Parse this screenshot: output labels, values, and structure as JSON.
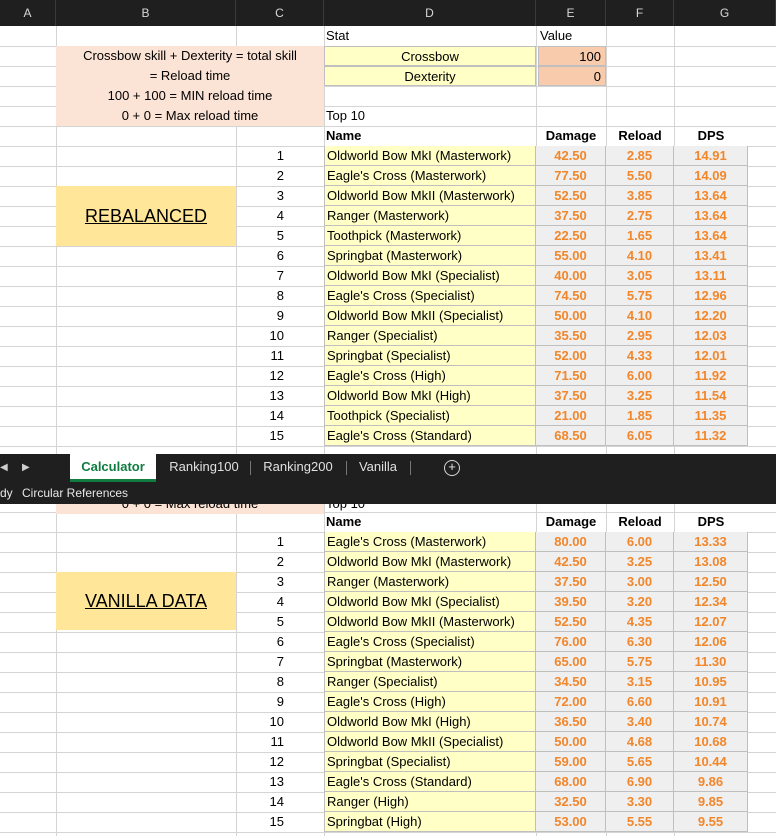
{
  "columns": [
    "A",
    "B",
    "C",
    "D",
    "E",
    "F",
    "G"
  ],
  "top": {
    "stat_header": "Stat",
    "value_header": "Value",
    "notes": [
      "Crossbow skill + Dexterity = total skill",
      "= Reload time",
      "100 + 100 = MIN reload time",
      "0 + 0 = Max reload time"
    ],
    "crossbow_label": "Crossbow",
    "crossbow_value": "100",
    "dexterity_label": "Dexterity",
    "dexterity_value": "0",
    "top10": "Top 10",
    "tag": "REBALANCED",
    "headers": {
      "name": "Name",
      "damage": "Damage",
      "reload": "Reload",
      "dps": "DPS"
    },
    "rows": [
      {
        "n": "1",
        "name": "Oldworld Bow MkI (Masterwork)",
        "damage": "42.50",
        "reload": "2.85",
        "dps": "14.91"
      },
      {
        "n": "2",
        "name": "Eagle's Cross (Masterwork)",
        "damage": "77.50",
        "reload": "5.50",
        "dps": "14.09"
      },
      {
        "n": "3",
        "name": "Oldworld Bow MkII (Masterwork)",
        "damage": "52.50",
        "reload": "3.85",
        "dps": "13.64"
      },
      {
        "n": "4",
        "name": "Ranger (Masterwork)",
        "damage": "37.50",
        "reload": "2.75",
        "dps": "13.64"
      },
      {
        "n": "5",
        "name": "Toothpick (Masterwork)",
        "damage": "22.50",
        "reload": "1.65",
        "dps": "13.64"
      },
      {
        "n": "6",
        "name": "Springbat (Masterwork)",
        "damage": "55.00",
        "reload": "4.10",
        "dps": "13.41"
      },
      {
        "n": "7",
        "name": "Oldworld Bow MkI (Specialist)",
        "damage": "40.00",
        "reload": "3.05",
        "dps": "13.11"
      },
      {
        "n": "8",
        "name": "Eagle's Cross (Specialist)",
        "damage": "74.50",
        "reload": "5.75",
        "dps": "12.96"
      },
      {
        "n": "9",
        "name": "Oldworld Bow MkII (Specialist)",
        "damage": "50.00",
        "reload": "4.10",
        "dps": "12.20"
      },
      {
        "n": "10",
        "name": "Ranger (Specialist)",
        "damage": "35.50",
        "reload": "2.95",
        "dps": "12.03"
      },
      {
        "n": "11",
        "name": "Springbat (Specialist)",
        "damage": "52.00",
        "reload": "4.33",
        "dps": "12.01"
      },
      {
        "n": "12",
        "name": "Eagle's Cross (High)",
        "damage": "71.50",
        "reload": "6.00",
        "dps": "11.92"
      },
      {
        "n": "13",
        "name": "Oldworld Bow MkI (High)",
        "damage": "37.50",
        "reload": "3.25",
        "dps": "11.54"
      },
      {
        "n": "14",
        "name": "Toothpick (Specialist)",
        "damage": "21.00",
        "reload": "1.85",
        "dps": "11.35"
      },
      {
        "n": "15",
        "name": "Eagle's Cross (Standard)",
        "damage": "68.50",
        "reload": "6.05",
        "dps": "11.32"
      }
    ]
  },
  "tabs": {
    "items": [
      "Calculator",
      "Ranking100",
      "Ranking200",
      "Vanilla"
    ],
    "active": "Calculator",
    "add_symbol": "+"
  },
  "statusbar": {
    "left": "dy",
    "circular": "Circular References"
  },
  "bottom": {
    "partial_note": "0 + 0 = Max reload time",
    "partial_top10": "Top 10",
    "tag": "VANILLA DATA",
    "headers": {
      "name": "Name",
      "damage": "Damage",
      "reload": "Reload",
      "dps": "DPS"
    },
    "rows": [
      {
        "n": "1",
        "name": "Eagle's Cross (Masterwork)",
        "damage": "80.00",
        "reload": "6.00",
        "dps": "13.33"
      },
      {
        "n": "2",
        "name": "Oldworld Bow MkI (Masterwork)",
        "damage": "42.50",
        "reload": "3.25",
        "dps": "13.08"
      },
      {
        "n": "3",
        "name": "Ranger (Masterwork)",
        "damage": "37.50",
        "reload": "3.00",
        "dps": "12.50"
      },
      {
        "n": "4",
        "name": "Oldworld Bow MkI (Specialist)",
        "damage": "39.50",
        "reload": "3.20",
        "dps": "12.34"
      },
      {
        "n": "5",
        "name": "Oldworld Bow MkII (Masterwork)",
        "damage": "52.50",
        "reload": "4.35",
        "dps": "12.07"
      },
      {
        "n": "6",
        "name": "Eagle's Cross (Specialist)",
        "damage": "76.00",
        "reload": "6.30",
        "dps": "12.06"
      },
      {
        "n": "7",
        "name": "Springbat (Masterwork)",
        "damage": "65.00",
        "reload": "5.75",
        "dps": "11.30"
      },
      {
        "n": "8",
        "name": "Ranger (Specialist)",
        "damage": "34.50",
        "reload": "3.15",
        "dps": "10.95"
      },
      {
        "n": "9",
        "name": "Eagle's Cross (High)",
        "damage": "72.00",
        "reload": "6.60",
        "dps": "10.91"
      },
      {
        "n": "10",
        "name": "Oldworld Bow MkI (High)",
        "damage": "36.50",
        "reload": "3.40",
        "dps": "10.74"
      },
      {
        "n": "11",
        "name": "Oldworld Bow MkII (Specialist)",
        "damage": "50.00",
        "reload": "4.68",
        "dps": "10.68"
      },
      {
        "n": "12",
        "name": "Springbat (Specialist)",
        "damage": "59.00",
        "reload": "5.65",
        "dps": "10.44"
      },
      {
        "n": "13",
        "name": "Eagle's Cross (Standard)",
        "damage": "68.00",
        "reload": "6.90",
        "dps": "9.86"
      },
      {
        "n": "14",
        "name": "Ranger (High)",
        "damage": "32.50",
        "reload": "3.30",
        "dps": "9.85"
      },
      {
        "n": "15",
        "name": "Springbat (High)",
        "damage": "53.00",
        "reload": "5.55",
        "dps": "9.55"
      }
    ]
  },
  "colors": {
    "name_bg": "#ffffc6",
    "value_text": "#f2862a",
    "note_bg": "#fbe3d6",
    "tag_bg": "#ffe699",
    "active_tab": "#107c41"
  }
}
